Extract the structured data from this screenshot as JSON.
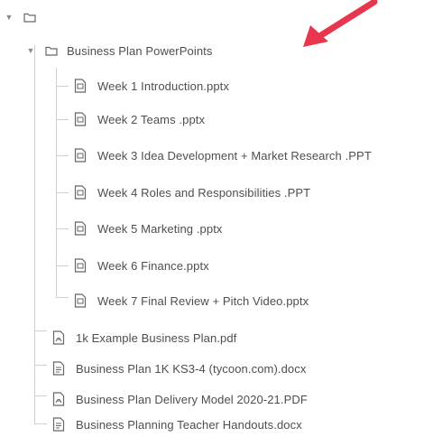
{
  "tree": {
    "root": {
      "label": ""
    },
    "folder": {
      "label": "Business Plan PowerPoints",
      "files": [
        {
          "label": "Week 1 Introduction.pptx",
          "icon": "pptx-file-icon"
        },
        {
          "label": "Week 2 Teams .pptx",
          "icon": "pptx-file-icon"
        },
        {
          "label": "Week 3 Idea Development + Market Research .PPT",
          "icon": "ppt-file-icon"
        },
        {
          "label": "Week 4 Roles and Responsibilities .PPT",
          "icon": "ppt-file-icon"
        },
        {
          "label": "Week 5 Marketing .pptx",
          "icon": "pptx-file-icon"
        },
        {
          "label": "Week 6 Finance.pptx",
          "icon": "pptx-file-icon"
        },
        {
          "label": "Week 7 Final Review + Pitch Video.pptx",
          "icon": "pptx-file-icon"
        }
      ]
    },
    "files": [
      {
        "label": "1k Example Business Plan.pdf",
        "icon": "pdf-file-icon"
      },
      {
        "label": "Business Plan 1K KS3-4 (tycoon.com).docx",
        "icon": "docx-file-icon"
      },
      {
        "label": "Business Plan Delivery Model 2020-21.PDF",
        "icon": "pdf-file-icon"
      },
      {
        "label": "Business Planning Teacher Handouts.docx",
        "icon": "docx-file-icon"
      }
    ]
  },
  "annotation": {
    "arrow_color": "#e8364e",
    "icon": "pointer-arrow-icon"
  }
}
